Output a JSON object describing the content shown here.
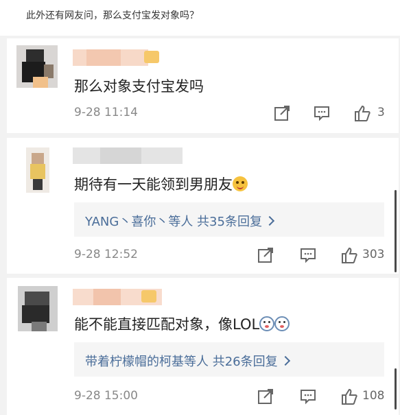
{
  "header": {
    "note": "此外还有网友问，那么支付宝发对象吗？"
  },
  "comments": [
    {
      "text": "那么对象支付宝发吗",
      "time": "9-28 11:14",
      "likes": "3"
    },
    {
      "text": "期待有一天能领到男朋友",
      "emoji": "smile-tongue-emoji",
      "reply_summary": "YANG丶喜你丶等人 共35条回复",
      "time": "9-28 12:52",
      "likes": "303"
    },
    {
      "text": "能不能直接匹配对象，像LOL",
      "emoji": "doge-emoji",
      "reply_summary": "带着柠檬帽的柯基等人 共26条回复",
      "time": "9-28 15:00",
      "likes": "108"
    }
  ],
  "icons": {
    "repost": "repost-icon",
    "comment": "comment-icon",
    "like": "thumbs-up-icon"
  },
  "colors": {
    "link": "#4a6d99",
    "text": "#222222",
    "muted": "#888888",
    "background": "#f2f2f2"
  }
}
